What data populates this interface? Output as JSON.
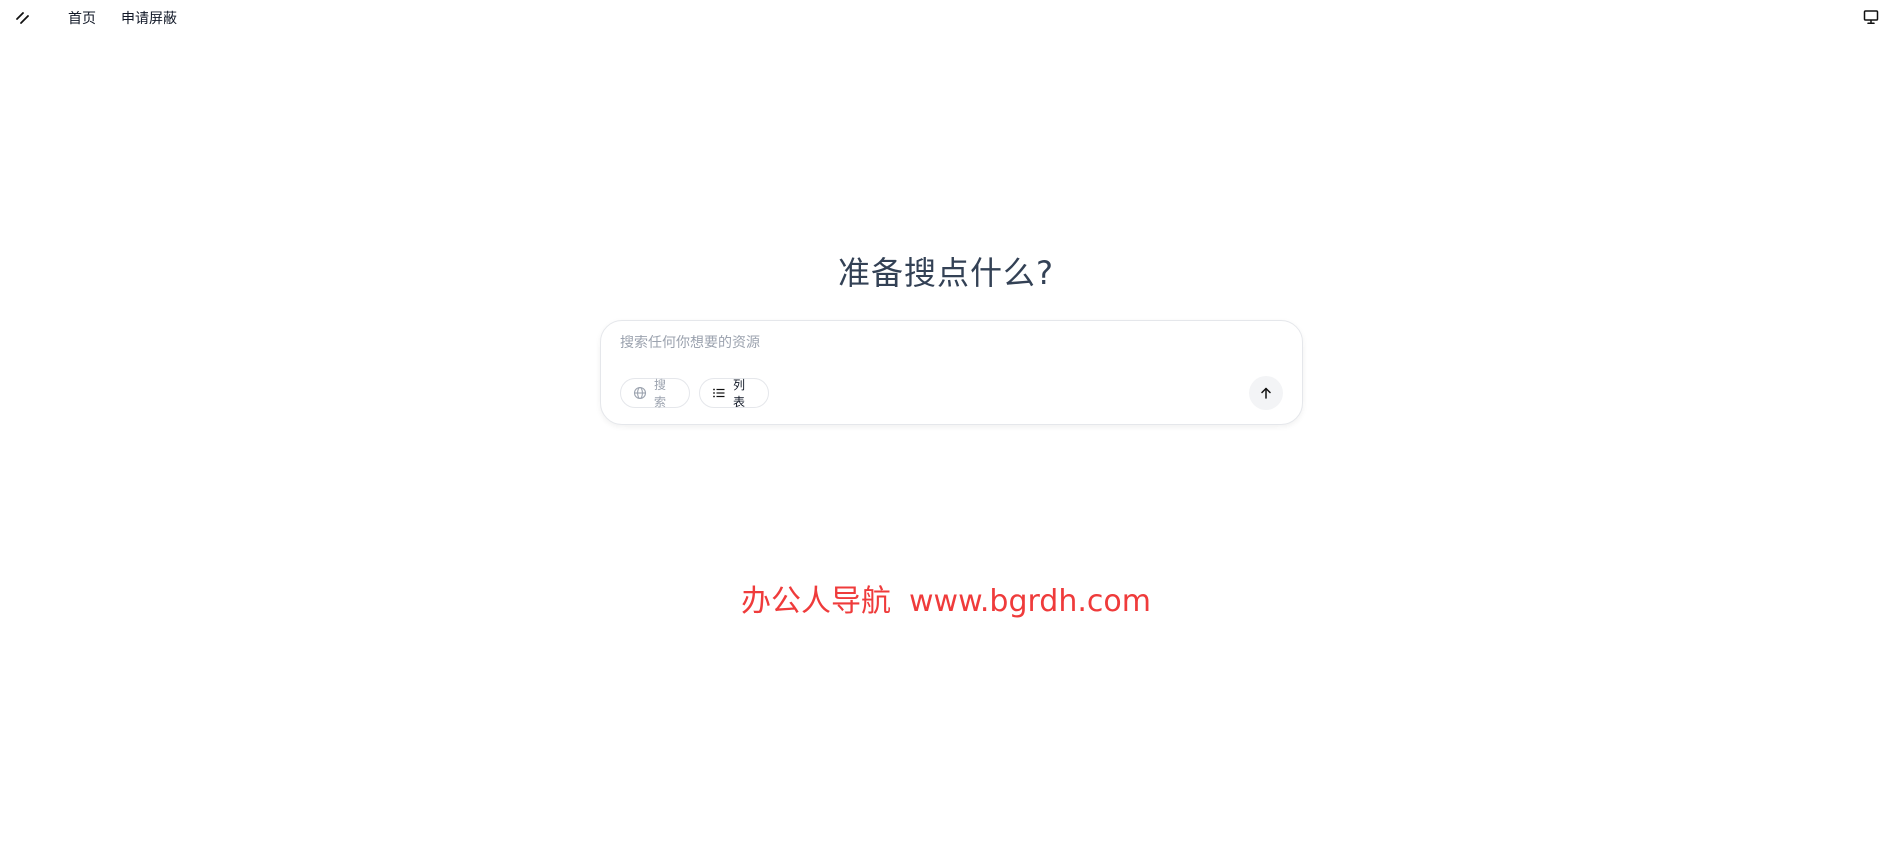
{
  "header": {
    "logo_icon": "slash-logo-icon",
    "nav": [
      {
        "label": "首页"
      },
      {
        "label": "申请屏蔽"
      }
    ],
    "right_icon": "monitor-icon"
  },
  "hero": {
    "title": "准备搜点什么?"
  },
  "search": {
    "placeholder": "搜索任何你想要的资源",
    "value": "",
    "chips": [
      {
        "label": "搜索",
        "icon": "globe-icon"
      },
      {
        "label": "列表",
        "icon": "list-icon"
      }
    ],
    "send_icon": "arrow-up-icon"
  },
  "watermark": {
    "name": "办公人导航",
    "url": "www.bgrdh.com"
  },
  "colors": {
    "watermark": "#ef3b3b",
    "title": "#334155",
    "border": "#e5e7eb"
  }
}
